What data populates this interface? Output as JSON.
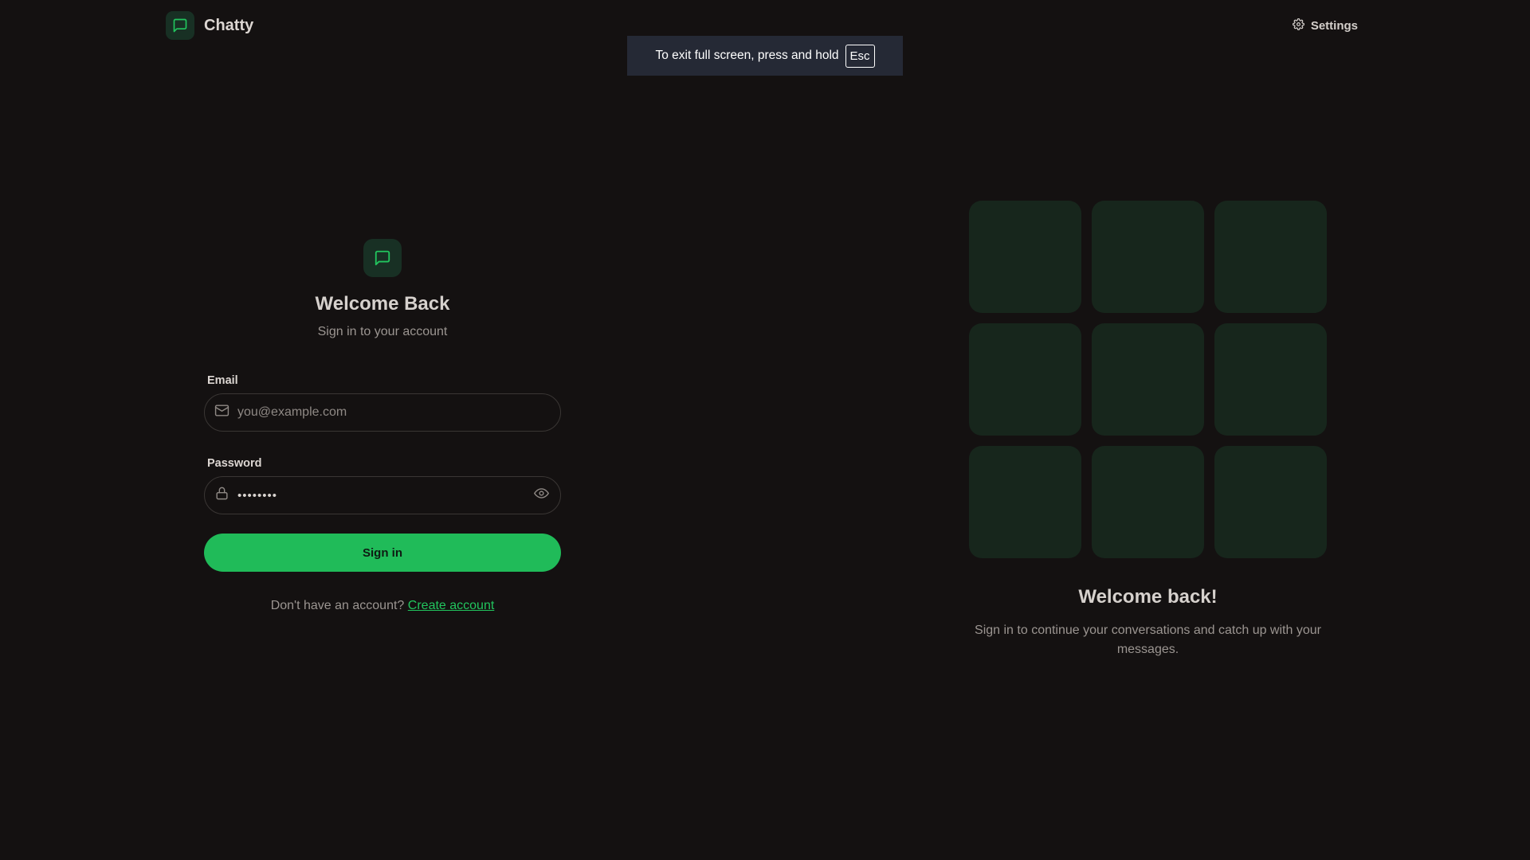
{
  "app": {
    "name": "Chatty"
  },
  "header": {
    "settings_label": "Settings"
  },
  "fullscreen_notice": {
    "text": "To exit full screen, press and hold",
    "key": "Esc"
  },
  "login": {
    "title": "Welcome Back",
    "subtitle": "Sign in to your account",
    "email_label": "Email",
    "email_placeholder": "you@example.com",
    "email_value": "",
    "password_label": "Password",
    "password_value": "••••••••",
    "submit_label": "Sign in",
    "signup_prompt": "Don't have an account?",
    "signup_link": "Create account"
  },
  "promo": {
    "title": "Welcome back!",
    "text": "Sign in to continue your conversations and catch up with your messages."
  },
  "colors": {
    "background": "#141111",
    "accent": "#22c55e",
    "button": "#20bb59",
    "tile": "#17261c",
    "icon_bg": "#183024"
  },
  "icons": {
    "brand": "message-square-icon",
    "settings": "gear-icon",
    "email": "mail-icon",
    "password": "lock-icon",
    "toggle_password": "eye-icon"
  }
}
